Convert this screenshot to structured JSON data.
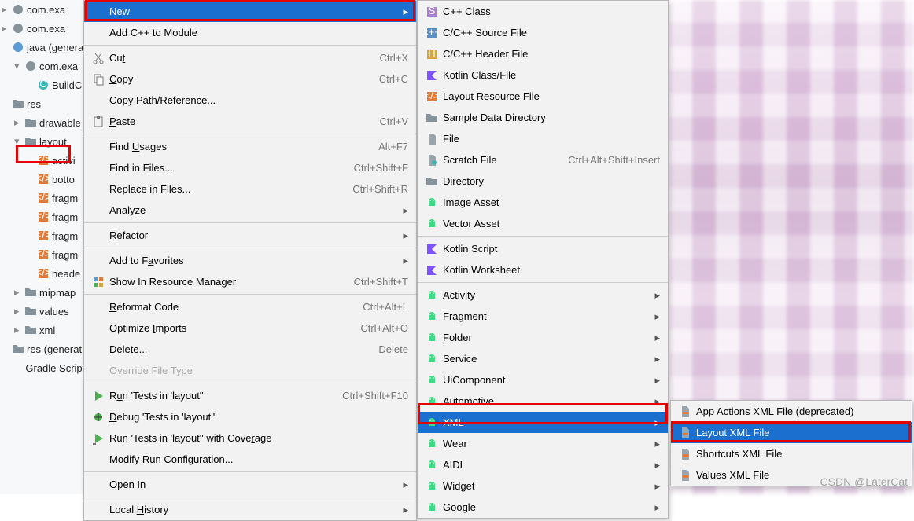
{
  "tree": [
    {
      "chev": "▸",
      "icon": "pkg",
      "label": "com.exa"
    },
    {
      "chev": "▸",
      "icon": "pkg",
      "label": "com.exa"
    },
    {
      "chev": "",
      "icon": "java",
      "label": "java (genera",
      "cls": ""
    },
    {
      "chev": "▾",
      "icon": "pkg",
      "label": "com.exa",
      "cls": "indented-1"
    },
    {
      "chev": "",
      "icon": "c",
      "label": "BuildC",
      "cls": "indented-2"
    },
    {
      "chev": "",
      "icon": "folder",
      "label": "res",
      "cls": ""
    },
    {
      "chev": "▸",
      "icon": "folder",
      "label": "drawable",
      "cls": "indented-1"
    },
    {
      "chev": "▾",
      "icon": "folder",
      "label": "layout",
      "cls": "indented-1"
    },
    {
      "chev": "",
      "icon": "xml",
      "label": "activi",
      "cls": "indented-2"
    },
    {
      "chev": "",
      "icon": "xml",
      "label": "botto",
      "cls": "indented-2"
    },
    {
      "chev": "",
      "icon": "xml",
      "label": "fragm",
      "cls": "indented-2"
    },
    {
      "chev": "",
      "icon": "xml",
      "label": "fragm",
      "cls": "indented-2"
    },
    {
      "chev": "",
      "icon": "xml",
      "label": "fragm",
      "cls": "indented-2"
    },
    {
      "chev": "",
      "icon": "xml",
      "label": "fragm",
      "cls": "indented-2"
    },
    {
      "chev": "",
      "icon": "xml",
      "label": "heade",
      "cls": "indented-2"
    },
    {
      "chev": "▸",
      "icon": "folder",
      "label": "mipmap",
      "cls": "indented-1"
    },
    {
      "chev": "▸",
      "icon": "folder",
      "label": "values",
      "cls": "indented-1"
    },
    {
      "chev": "▸",
      "icon": "folder",
      "label": "xml",
      "cls": "indented-1"
    },
    {
      "chev": "",
      "icon": "folder",
      "label": "res (generat",
      "cls": ""
    },
    {
      "chev": "",
      "icon": "",
      "label": "Gradle Scripts",
      "cls": ""
    }
  ],
  "menu1": [
    {
      "icon": "",
      "label": "New",
      "shortcut": "",
      "arrow": true,
      "selected": true,
      "sep": false
    },
    {
      "icon": "",
      "label": "Add C++ to Module",
      "shortcut": "",
      "arrow": false,
      "sep": false
    },
    {
      "sep": true
    },
    {
      "icon": "cut",
      "label": "Cut",
      "shortcut": "Ctrl+X",
      "u": 2
    },
    {
      "icon": "copy",
      "label": "Copy",
      "shortcut": "Ctrl+C",
      "u": 0
    },
    {
      "icon": "",
      "label": "Copy Path/Reference...",
      "shortcut": ""
    },
    {
      "icon": "paste",
      "label": "Paste",
      "shortcut": "Ctrl+V",
      "u": 0
    },
    {
      "sep": true
    },
    {
      "icon": "",
      "label": "Find Usages",
      "shortcut": "Alt+F7",
      "u": 5
    },
    {
      "icon": "",
      "label": "Find in Files...",
      "shortcut": "Ctrl+Shift+F"
    },
    {
      "icon": "",
      "label": "Replace in Files...",
      "shortcut": "Ctrl+Shift+R"
    },
    {
      "icon": "",
      "label": "Analyze",
      "shortcut": "",
      "arrow": true,
      "u": 5
    },
    {
      "sep": true
    },
    {
      "icon": "",
      "label": "Refactor",
      "shortcut": "",
      "arrow": true,
      "u": 0
    },
    {
      "sep": true
    },
    {
      "icon": "",
      "label": "Add to Favorites",
      "shortcut": "",
      "arrow": true,
      "u": 8
    },
    {
      "icon": "res",
      "label": "Show In Resource Manager",
      "shortcut": "Ctrl+Shift+T"
    },
    {
      "sep": true
    },
    {
      "icon": "",
      "label": "Reformat Code",
      "shortcut": "Ctrl+Alt+L",
      "u": 0
    },
    {
      "icon": "",
      "label": "Optimize Imports",
      "shortcut": "Ctrl+Alt+O",
      "u": 9
    },
    {
      "icon": "",
      "label": "Delete...",
      "shortcut": "Delete",
      "u": 0
    },
    {
      "icon": "",
      "label": "Override File Type",
      "shortcut": "",
      "disabled": true
    },
    {
      "sep": true
    },
    {
      "icon": "run",
      "label": "Run 'Tests in 'layout''",
      "shortcut": "Ctrl+Shift+F10",
      "u": 1
    },
    {
      "icon": "debug",
      "label": "Debug 'Tests in 'layout''",
      "shortcut": "",
      "u": 0
    },
    {
      "icon": "coverage",
      "label": "Run 'Tests in 'layout'' with Coverage",
      "shortcut": "",
      "u": 33
    },
    {
      "icon": "",
      "label": "Modify Run Configuration...",
      "shortcut": ""
    },
    {
      "sep": true
    },
    {
      "icon": "",
      "label": "Open In",
      "shortcut": "",
      "arrow": true
    },
    {
      "sep": true
    },
    {
      "icon": "",
      "label": "Local History",
      "shortcut": "",
      "arrow": true,
      "u": 6
    }
  ],
  "menu2": [
    {
      "icon": "cpp",
      "label": "C++ Class"
    },
    {
      "icon": "cppsrc",
      "label": "C/C++ Source File"
    },
    {
      "icon": "cpphdr",
      "label": "C/C++ Header File"
    },
    {
      "icon": "kotlin",
      "label": "Kotlin Class/File"
    },
    {
      "icon": "xml",
      "label": "Layout Resource File"
    },
    {
      "icon": "folder",
      "label": "Sample Data Directory"
    },
    {
      "icon": "file",
      "label": "File"
    },
    {
      "icon": "scratch",
      "label": "Scratch File",
      "shortcut": "Ctrl+Alt+Shift+Insert"
    },
    {
      "icon": "folder",
      "label": "Directory"
    },
    {
      "icon": "android",
      "label": "Image Asset"
    },
    {
      "icon": "android",
      "label": "Vector Asset"
    },
    {
      "sep": true
    },
    {
      "icon": "kotlin",
      "label": "Kotlin Script"
    },
    {
      "icon": "kotlin",
      "label": "Kotlin Worksheet"
    },
    {
      "sep": true
    },
    {
      "icon": "android",
      "label": "Activity",
      "arrow": true
    },
    {
      "icon": "android",
      "label": "Fragment",
      "arrow": true
    },
    {
      "icon": "android",
      "label": "Folder",
      "arrow": true
    },
    {
      "icon": "android",
      "label": "Service",
      "arrow": true
    },
    {
      "icon": "android",
      "label": "UiComponent",
      "arrow": true
    },
    {
      "icon": "android",
      "label": "Automotive",
      "arrow": true
    },
    {
      "icon": "android",
      "label": "XML",
      "arrow": true,
      "selected": true
    },
    {
      "icon": "android",
      "label": "Wear",
      "arrow": true
    },
    {
      "icon": "android",
      "label": "AIDL",
      "arrow": true
    },
    {
      "icon": "android",
      "label": "Widget",
      "arrow": true
    },
    {
      "icon": "android",
      "label": "Google",
      "arrow": true
    }
  ],
  "menu3": [
    {
      "icon": "xmlf",
      "label": "App Actions XML File (deprecated)"
    },
    {
      "icon": "xmlf",
      "label": "Layout XML File",
      "selected": true
    },
    {
      "icon": "xmlf",
      "label": "Shortcuts XML File"
    },
    {
      "icon": "xmlf",
      "label": "Values XML File"
    }
  ],
  "watermark": "CSDN @LaterCat"
}
